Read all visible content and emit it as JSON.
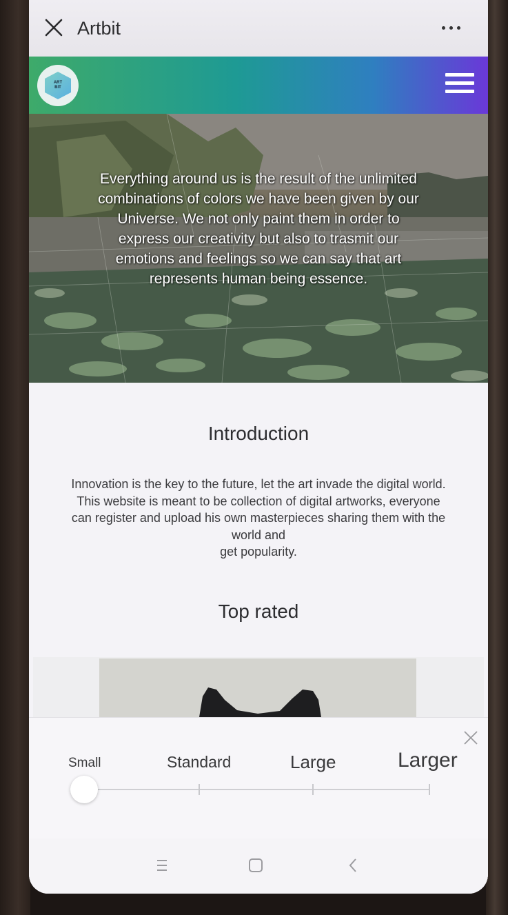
{
  "app_bar": {
    "title": "Artbit"
  },
  "navbar": {
    "logo_text_line1": "ART",
    "logo_text_line2": "BIT"
  },
  "hero": {
    "text": "Everything around us is the result of the unlimited combinations of colors we have been given by our Universe. We not only paint them in order to express our creativity but also to trasmit our emotions and feelings so we can say that art represents human being essence."
  },
  "intro": {
    "title": "Introduction",
    "line1": "Innovation is the key to the future, let the art invade the digital world.",
    "line2": "This website is meant to be collection of digital artworks, everyone",
    "line3": "can register and upload his own masterpieces sharing them with the",
    "line4": "world and",
    "line5": "get popularity."
  },
  "top_rated": {
    "title": "Top rated"
  },
  "font_size_panel": {
    "options": [
      "Small",
      "Standard",
      "Large",
      "Larger"
    ],
    "selected": "Small"
  },
  "colors": {
    "navbar_gradient_start": "#3eaa6a",
    "navbar_gradient_end": "#6a38d8"
  }
}
